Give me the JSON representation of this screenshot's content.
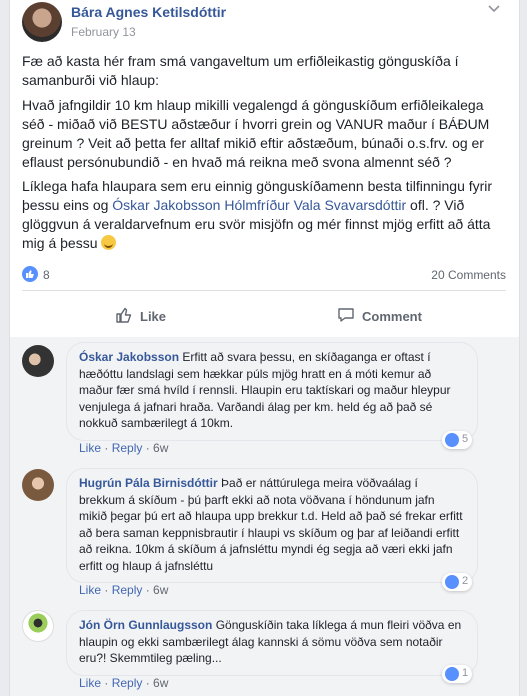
{
  "post": {
    "author": "Bára Agnes Ketilsdóttir",
    "date": "February 13",
    "paragraph1": "Fæ að kasta hér fram smá vangaveltum um erfiðleikastig gönguskíða í samanburði við hlaup:",
    "paragraph2": "Hvað jafngildir 10 km hlaup mikilli vegalengd á gönguskíðum erfiðleikalega séð - miðað við BESTU aðstæður í hvorri grein og VANUR maður í BÁÐUM greinum ? Veit að þetta fer alltaf mikið eftir aðstæðum, búnaði o.s.frv. og er eflaust persónubundið - en hvað má reikna með svona almennt séð ?",
    "paragraph3_a": "Líklega hafa hlaupara sem eru einnig gönguskíðamenn besta tilfinningu fyrir þessu eins og ",
    "paragraph3_links": "Óskar Jakobsson Hólmfríður Vala Svavarsdóttir",
    "paragraph3_b": " ofl. ? Við glöggvun á veraldarvefnum eru svör misjöfn og mér finnst mjög erfitt að átta mig á þessu ",
    "reaction_count": "8",
    "comment_count": "20 Comments"
  },
  "actions": {
    "like_label": "Like",
    "comment_label": "Comment"
  },
  "comments": [
    {
      "name": "Óskar Jakobsson",
      "text": "Erfitt að svara þessu, en skíðaganga er oftast í hæðóttu landslagi sem hækkar púls mjög hratt en á móti kemur að maður fær smá hvíld í rennsli. Hlaupin eru taktískari og maður hleypur venjulega á jafnari hraða. Varðandi álag per km. held ég að það sé nokkuð sambærilegt á 10km.",
      "like": "Like",
      "reply": "Reply",
      "time": "6w",
      "likes": "5"
    },
    {
      "name": "Hugrún Pála Birnisdóttir",
      "text": "Það er náttúrulega meira vöðvaálag í brekkum á skíðum - þú þarft ekki að nota vöðvana í höndunum jafn mikið þegar þú ert að hlaupa upp brekkur t.d. Held að það sé frekar erfitt að bera saman keppnisbrautir í hlaupi vs skíðum og þar af leiðandi erfitt að reikna. 10km á skíðum á jafnsléttu myndi ég segja að væri ekki jafn erfitt og hlaup á jafnsléttu",
      "like": "Like",
      "reply": "Reply",
      "time": "6w",
      "likes": "2"
    },
    {
      "name": "Jón Örn Gunnlaugsson",
      "text": "Gönguskíðin taka líklega á mun fleiri vöðva en hlaupin og ekki sambærilegt álag kannski á sömu vöðva sem notaðir eru?! Skemmtileg pæling...",
      "like": "Like",
      "reply": "Reply",
      "time": "6w",
      "likes": "1"
    }
  ],
  "colors": {
    "link": "#365899",
    "accent": "#5890ff",
    "text": "#1d2129",
    "meta": "#606770"
  }
}
